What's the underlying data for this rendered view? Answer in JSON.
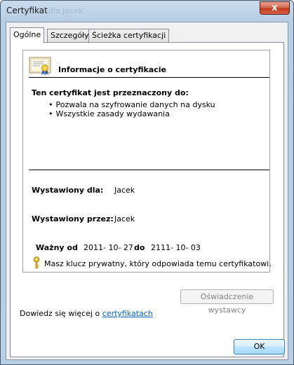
{
  "window": {
    "title": "Certyfikat",
    "title_ghost": "dla Jacek",
    "close_glyph": "x"
  },
  "tabs": [
    {
      "label": "Ogólne",
      "active": true
    },
    {
      "label": "Szczegóły",
      "active": false
    },
    {
      "label": "Ścieżka certyfikacji",
      "active": false
    }
  ],
  "info": {
    "title": "Informacje o certyfikacie",
    "purpose_title": "Ten certyfikat jest przeznaczony do:",
    "purposes": [
      "Pozwala na szyfrowanie danych na dysku",
      "Wszystkie zasady wydawania"
    ],
    "issued_to_label": "Wystawiony dla:",
    "issued_to_value": "Jacek",
    "issued_by_label": "Wystawiony przez:",
    "issued_by_value": "Jacek",
    "valid_label": "Ważny od",
    "valid_from": "2011- 10- 27",
    "valid_to_label": "do",
    "valid_to": "2111- 10- 03",
    "private_key_note": "Masz klucz prywatny, który odpowiada temu certyfikatowi."
  },
  "buttons": {
    "issuer_statement": "Oświadczenie wystawcy",
    "ok": "OK"
  },
  "learn_more": {
    "prefix": "Dowiedz się więcej o ",
    "link": "certyfikatach"
  },
  "colors": {
    "link": "#0066cc",
    "close_button": "#c43a1c",
    "ok_border": "#3c7fb1"
  },
  "icons": [
    "certificate-icon",
    "key-icon",
    "close-icon"
  ]
}
